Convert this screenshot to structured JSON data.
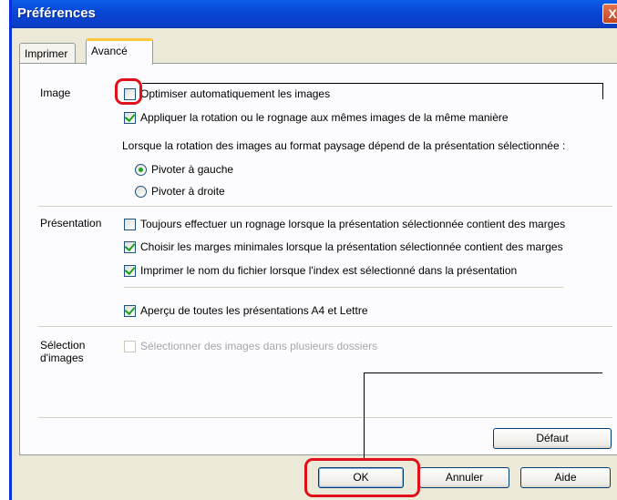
{
  "window": {
    "title": "Préférences",
    "close_glyph": "X"
  },
  "tabs": [
    {
      "label": "Imprimer",
      "active": false
    },
    {
      "label": "Avancé",
      "active": true
    }
  ],
  "image_section": {
    "label": "Image",
    "optimize_label": "Optimiser automatiquement les images",
    "optimize_checked": false,
    "rotation_label": "Appliquer la rotation ou le rognage aux mêmes images de la même manière",
    "rotation_checked": true,
    "landscape_text": "Lorsque la rotation des images au format paysage dépend de la présentation sélectionnée :",
    "rotate_left_label": "Pivoter à gauche",
    "rotate_left_selected": true,
    "rotate_right_label": "Pivoter à droite",
    "rotate_right_selected": false
  },
  "layout_section": {
    "label": "Présentation",
    "always_crop_label": "Toujours effectuer un rognage lorsque la présentation sélectionnée contient des marges",
    "always_crop_checked": false,
    "min_margins_label": "Choisir les marges minimales lorsque la présentation sélectionnée contient des marges",
    "min_margins_checked": true,
    "print_filename_label": "Imprimer le nom du fichier lorsque l'index est sélectionné dans la présentation",
    "print_filename_checked": true,
    "preview_label": "Aperçu de toutes les présentations A4 et Lettre",
    "preview_checked": true
  },
  "image_selection_section": {
    "label_line1": "Sélection",
    "label_line2": "d'images",
    "multi_folder_label": "Sélectionner des images dans plusieurs dossiers",
    "multi_folder_checked": false,
    "multi_folder_enabled": false
  },
  "buttons": {
    "default_label": "Défaut",
    "ok_label": "OK",
    "cancel_label": "Annuler",
    "help_label": "Aide"
  },
  "colors": {
    "titlebar": "#0a4fd8",
    "dialog_bg": "#ece9d8",
    "highlight": "#e0101a",
    "check_green": "#21a121"
  }
}
